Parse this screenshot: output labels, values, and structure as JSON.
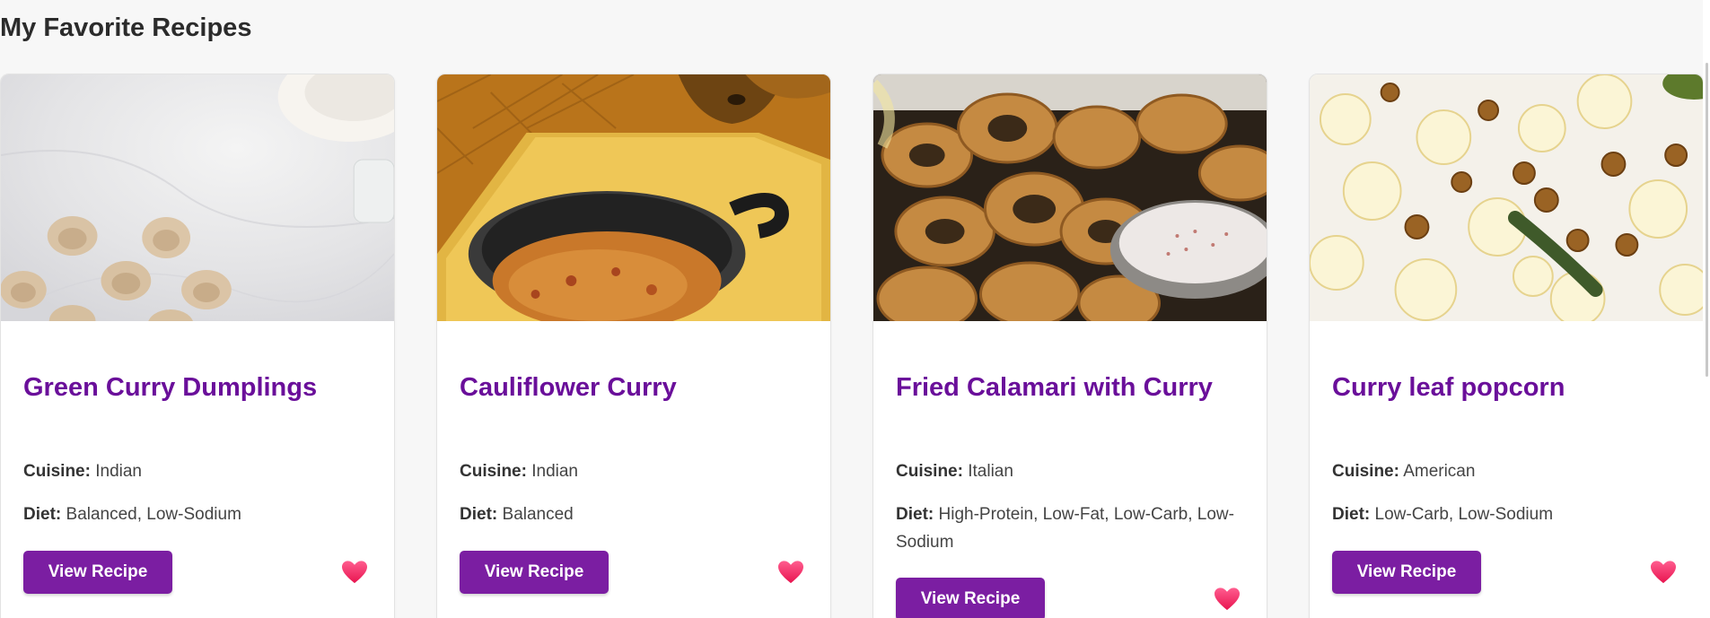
{
  "page": {
    "title": "My Favorite Recipes"
  },
  "colors": {
    "accent": "#7b1ea2",
    "title": "#6a0f9a",
    "heart": "#ff2a6d"
  },
  "recipes": [
    {
      "title": "Green Curry Dumplings",
      "image_icon": "dumplings-photo",
      "cuisine_label": "Cuisine:",
      "cuisine": "Indian",
      "diet_label": "Diet:",
      "diet": "Balanced, Low-Sodium",
      "button_label": "View Recipe",
      "favorite_icon": "heart-icon"
    },
    {
      "title": "Cauliflower Curry",
      "image_icon": "curry-pot-photo",
      "cuisine_label": "Cuisine:",
      "cuisine": "Indian",
      "diet_label": "Diet:",
      "diet": "Balanced",
      "button_label": "View Recipe",
      "favorite_icon": "heart-icon"
    },
    {
      "title": "Fried Calamari with Curry",
      "image_icon": "calamari-photo",
      "cuisine_label": "Cuisine:",
      "cuisine": "Italian",
      "diet_label": "Diet:",
      "diet": "High-Protein, Low-Fat, Low-Carb, Low-Sodium",
      "button_label": "View Recipe",
      "favorite_icon": "heart-icon"
    },
    {
      "title": "Curry leaf popcorn",
      "image_icon": "popcorn-photo",
      "cuisine_label": "Cuisine:",
      "cuisine": "American",
      "diet_label": "Diet:",
      "diet": "Low-Carb, Low-Sodium",
      "button_label": "View Recipe",
      "favorite_icon": "heart-icon"
    }
  ]
}
